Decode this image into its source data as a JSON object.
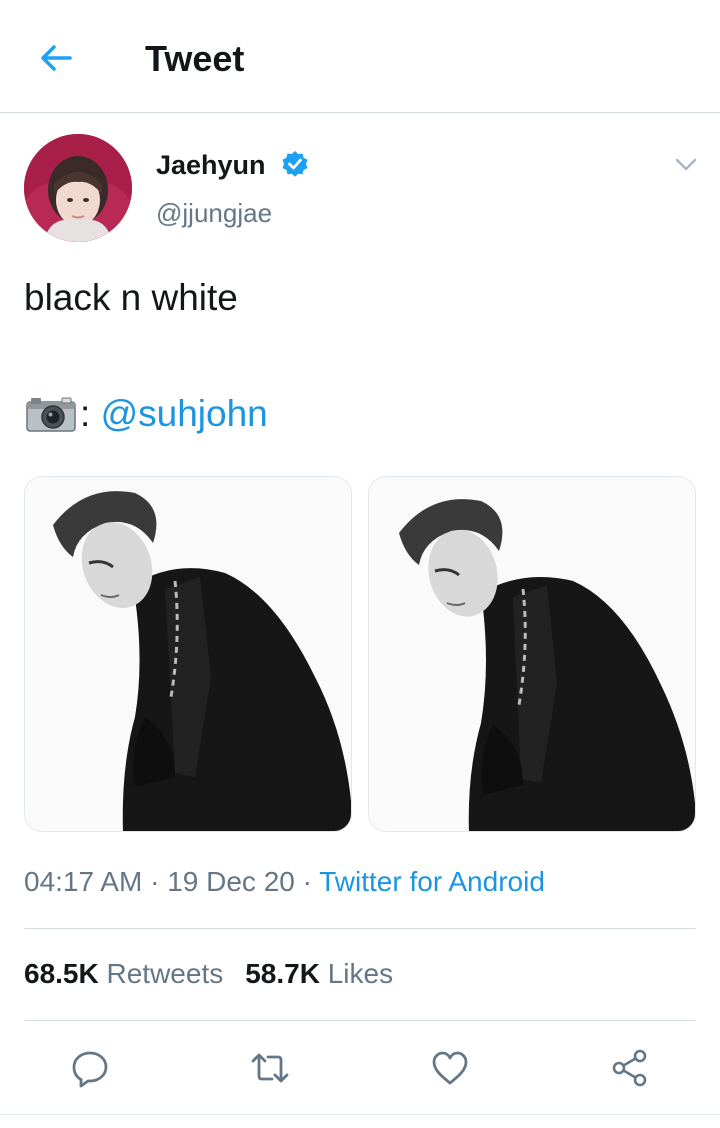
{
  "header": {
    "title": "Tweet",
    "back_icon": "arrow-left-icon",
    "accent": "#1da1f2"
  },
  "author": {
    "name": "Jaehyun",
    "handle": "@jjungjae",
    "verified": true,
    "menu_icon": "chevron-down-icon"
  },
  "tweet": {
    "text": "black n white",
    "credit_emoji": "camera-icon",
    "credit_separator": ":",
    "mention": "@suhjohn",
    "media_count": 2
  },
  "meta": {
    "time": "04:17 AM",
    "date": "19 Dec 20",
    "separator": " · ",
    "client": "Twitter for Android"
  },
  "stats": {
    "retweets_count": "68.5K",
    "retweets_label": "Retweets",
    "likes_count": "58.7K",
    "likes_label": "Likes"
  },
  "actions": [
    "reply-icon",
    "retweet-icon",
    "like-icon",
    "share-icon"
  ],
  "colors": {
    "link": "#1b95e0",
    "muted": "#657786",
    "text": "#14171a",
    "divider": "#d6dde3"
  }
}
